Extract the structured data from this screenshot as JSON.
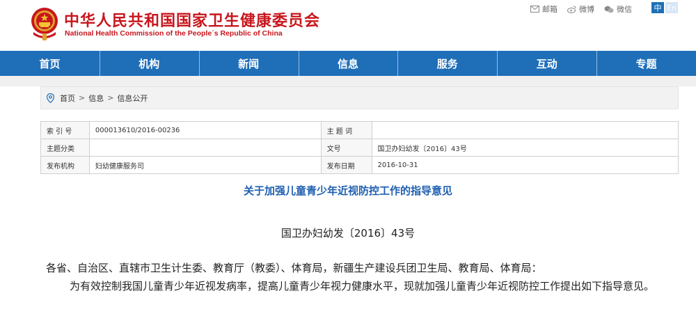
{
  "header": {
    "title": "中华人民共和国国家卫生健康委员会",
    "subtitle": "National Health Commission of the People´s Republic of China",
    "links": {
      "mail": "邮箱",
      "weibo": "微博",
      "wechat": "微信"
    },
    "lang_zh": "中",
    "lang_en": "En"
  },
  "nav": {
    "items": [
      "首页",
      "机构",
      "新闻",
      "信息",
      "服务",
      "互动",
      "专题"
    ]
  },
  "breadcrumb": {
    "items": [
      "首页",
      "信息",
      "信息公开"
    ],
    "separator": ">"
  },
  "info_table": {
    "index_label": "索 引 号",
    "index_value": "000013610/2016-00236",
    "subject_label": "主 题 词",
    "subject_value": "",
    "category_label": "主题分类",
    "category_value": "",
    "docnum_label": "文号",
    "docnum_value": "国卫办妇幼发〔2016〕43号",
    "publisher_label": "发布机构",
    "publisher_value": "妇幼健康服务司",
    "date_label": "发布日期",
    "date_value": "2016-10-31"
  },
  "article": {
    "title": "关于加强儿童青少年近视防控工作的指导意见",
    "doc_number": "国卫办妇幼发〔2016〕43号",
    "paragraph1": "各省、自治区、直辖市卫生计生委、教育厅（教委）、体育局，新疆生产建设兵团卫生局、教育局、体育局：",
    "paragraph2": "为有效控制我国儿童青少年近视发病率，提高儿童青少年视力健康水平，现就加强儿童青少年近视防控工作提出如下指导意见。"
  },
  "colors": {
    "brand_red": "#c8161d",
    "nav_blue": "#1f6eb8",
    "title_blue": "#1e5fb0"
  }
}
